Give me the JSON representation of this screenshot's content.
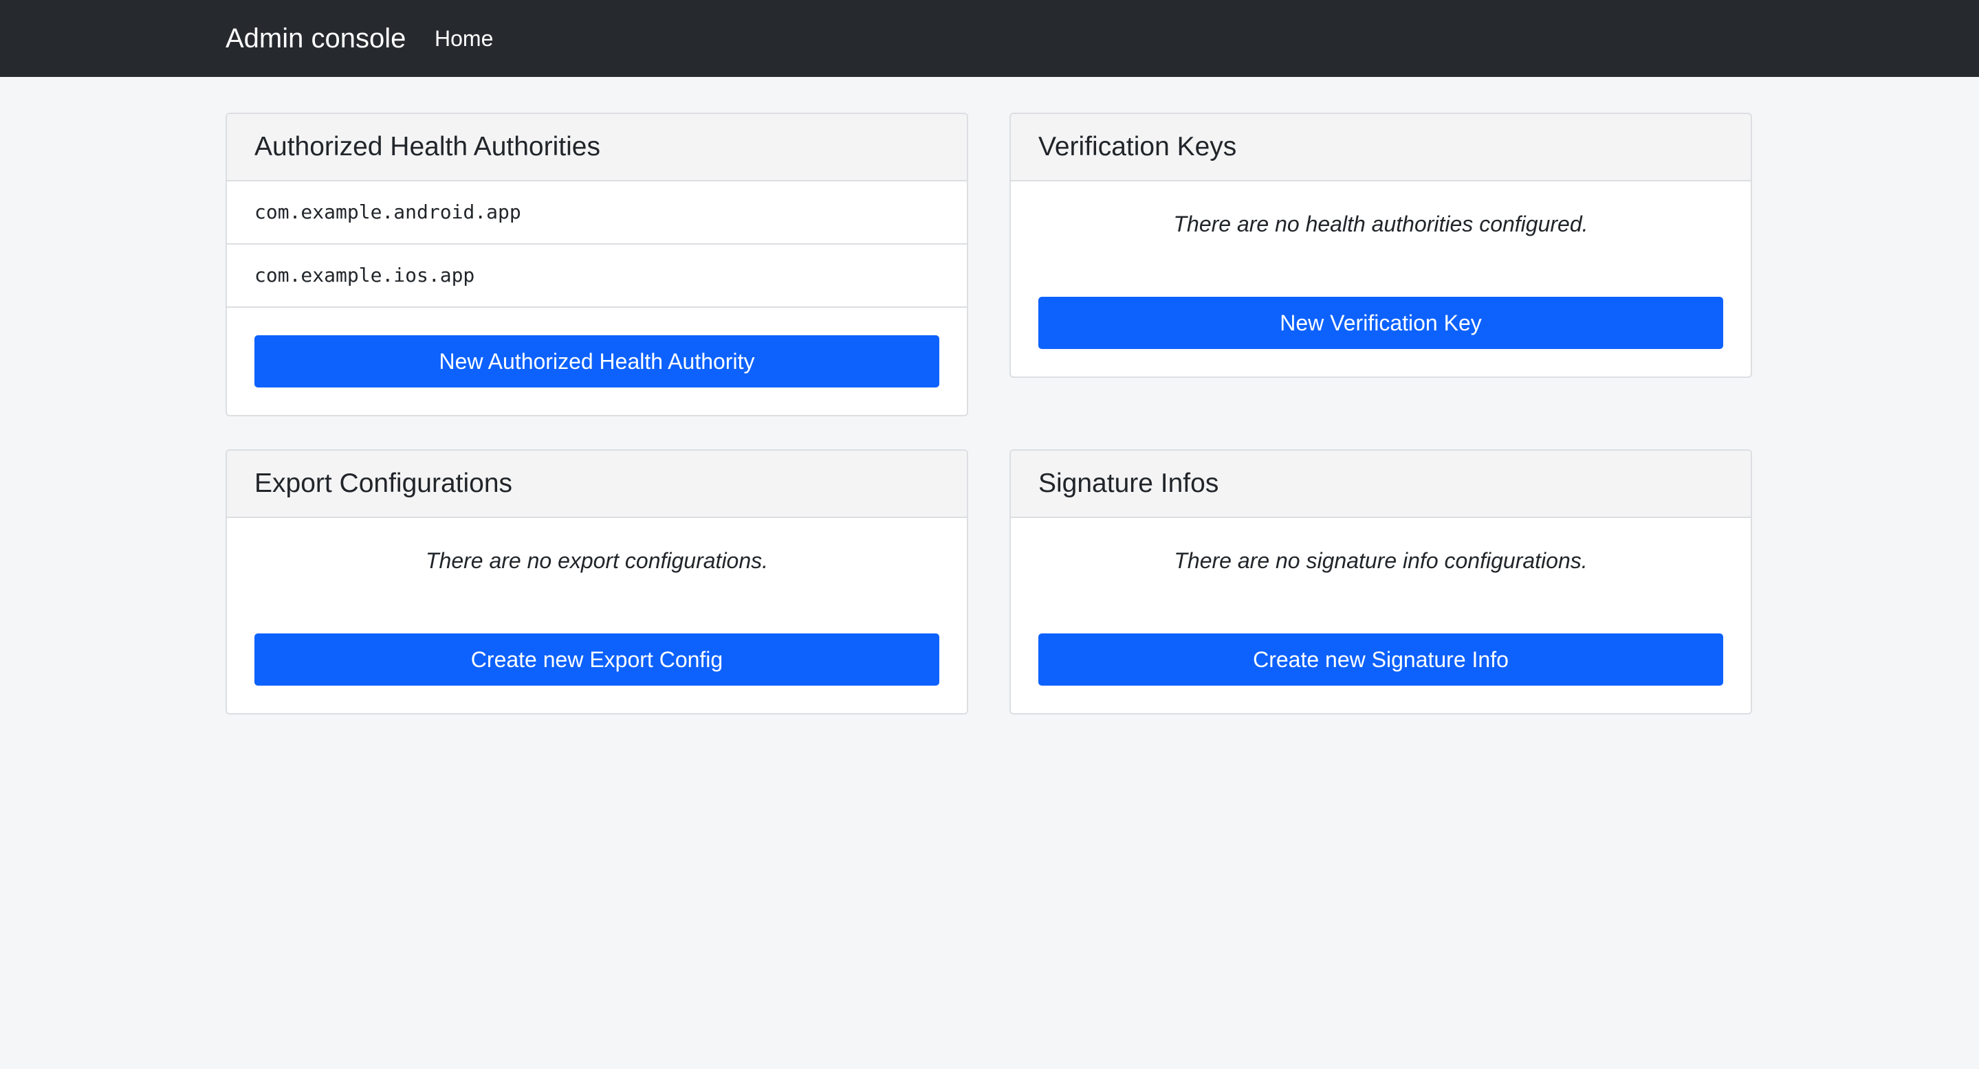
{
  "navbar": {
    "brand": "Admin console",
    "home_link": "Home"
  },
  "cards": {
    "health_authorities": {
      "title": "Authorized Health Authorities",
      "items": [
        "com.example.android.app",
        "com.example.ios.app"
      ],
      "button_label": "New Authorized Health Authority"
    },
    "verification_keys": {
      "title": "Verification Keys",
      "empty_message": "There are no health authorities configured.",
      "button_label": "New Verification Key"
    },
    "export_configurations": {
      "title": "Export Configurations",
      "empty_message": "There are no export configurations.",
      "button_label": "Create new Export Config"
    },
    "signature_infos": {
      "title": "Signature Infos",
      "empty_message": "There are no signature info configurations.",
      "button_label": "Create new Signature Info"
    }
  },
  "colors": {
    "navbar_bg": "#262a2f",
    "page_bg": "#f5f6f8",
    "primary_button": "#0d62fd",
    "card_header_bg": "#f4f4f5"
  }
}
